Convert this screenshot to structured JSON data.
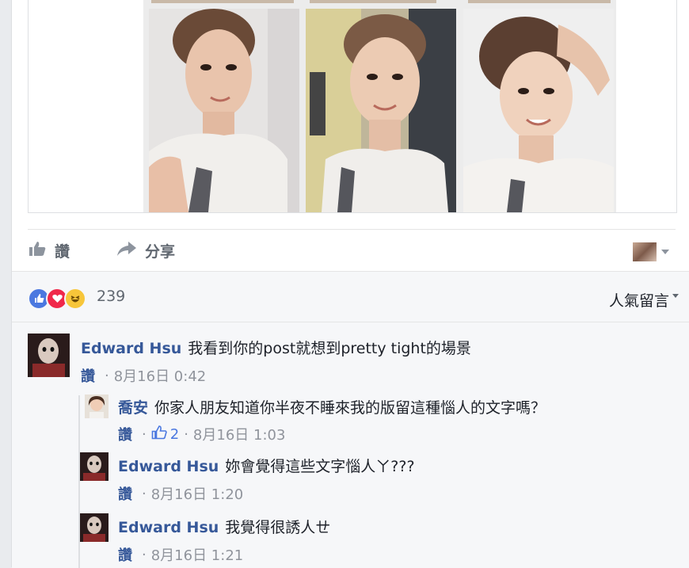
{
  "actions": {
    "like": "讚",
    "share": "分享"
  },
  "reactions": {
    "count": "239",
    "sort_label": "人氣留言"
  },
  "comments": [
    {
      "name": "Edward Hsu",
      "text": "我看到你的post就想到pretty tight的場景",
      "like": "讚",
      "time": "8月16日 0:42"
    },
    {
      "name": "喬安",
      "text": "你家人朋友知道你半夜不睡來我的版留這種惱人的文字嗎？",
      "like": "讚",
      "like_count": "2",
      "time": "8月16日 1:03"
    },
    {
      "name": "Edward Hsu",
      "text": "妳會覺得這些文字惱人ㄚ???",
      "like": "讚",
      "time": "8月16日 1:20"
    },
    {
      "name": "Edward Hsu",
      "text": "我覺得很誘人ㄝ",
      "like": "讚",
      "time": "8月16日 1:21"
    }
  ],
  "colors": {
    "link": "#365899",
    "like_blue": "#4b78e0",
    "love_red": "#f0284a",
    "haha_yellow": "#f7c63a"
  }
}
